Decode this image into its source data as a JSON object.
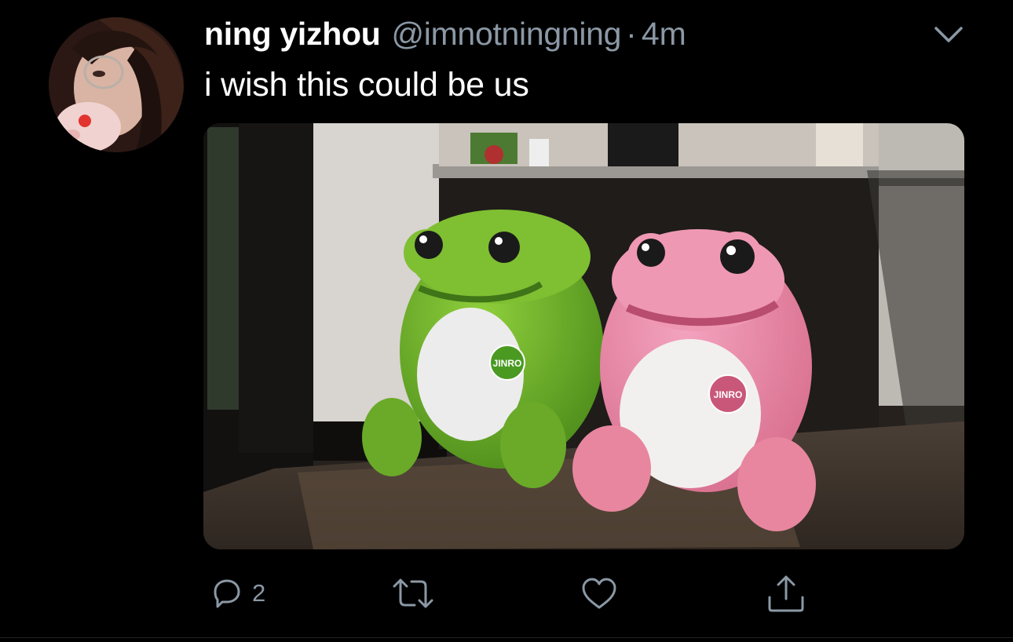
{
  "tweet": {
    "author_name": "ning yizhou",
    "handle": "@imnotningning",
    "separator": "·",
    "time": "4m",
    "text": "i wish this could be us",
    "media": {
      "frog_left_badge": "JINRO",
      "frog_right_badge": "JINRO"
    },
    "actions": {
      "reply_count": "2"
    }
  },
  "colors": {
    "background": "#000000",
    "text": "#ffffff",
    "secondary": "#8b98a5"
  },
  "icons": [
    "chevron-down-icon",
    "reply-icon",
    "retweet-icon",
    "like-icon",
    "share-icon"
  ]
}
